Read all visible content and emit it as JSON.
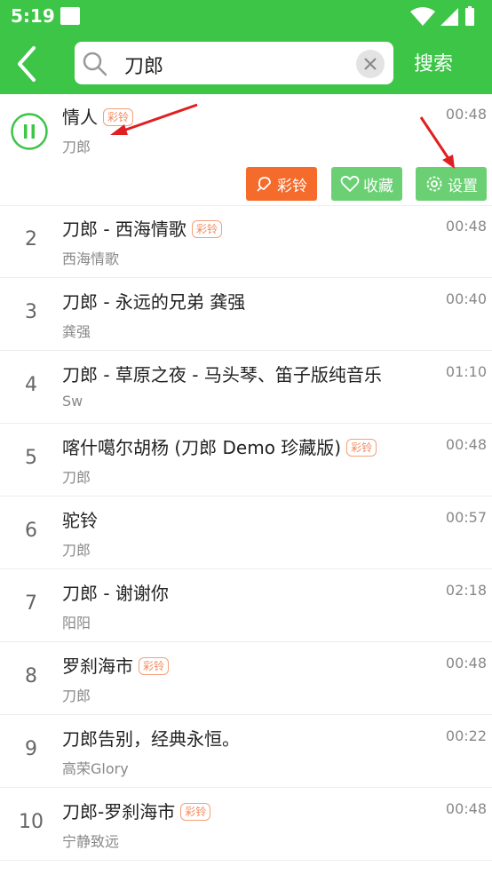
{
  "status_bar": {
    "time": "5:19"
  },
  "search": {
    "query": "刀郎",
    "submit_label": "搜索"
  },
  "badge_label": "彩铃",
  "now_playing": {
    "title": "情人",
    "artist": "刀郎",
    "duration": "00:48",
    "actions": {
      "ringtone": "彩铃",
      "favorite": "收藏",
      "settings": "设置"
    }
  },
  "songs": [
    {
      "num": "2",
      "title": "刀郎 - 西海情歌",
      "artist": "西海情歌",
      "duration": "00:48",
      "badge": true
    },
    {
      "num": "3",
      "title": "刀郎 - 永远的兄弟 龚强",
      "artist": "龚强",
      "duration": "00:40",
      "badge": false
    },
    {
      "num": "4",
      "title": "刀郎 - 草原之夜 - 马头琴、笛子版纯音乐",
      "artist": "Sw",
      "duration": "01:10",
      "badge": false
    },
    {
      "num": "5",
      "title": "喀什噶尔胡杨 (刀郎 Demo 珍藏版)",
      "artist": "刀郎",
      "duration": "00:48",
      "badge": true
    },
    {
      "num": "6",
      "title": "驼铃",
      "artist": "刀郎",
      "duration": "00:57",
      "badge": false
    },
    {
      "num": "7",
      "title": "刀郎 - 谢谢你",
      "artist": "阳阳",
      "duration": "02:18",
      "badge": false
    },
    {
      "num": "8",
      "title": "罗刹海市",
      "artist": "刀郎",
      "duration": "00:48",
      "badge": true
    },
    {
      "num": "9",
      "title": "刀郎告别，经典永恒。",
      "artist": "高荣Glory",
      "duration": "00:22",
      "badge": false
    },
    {
      "num": "10",
      "title": "刀郎-罗刹海市",
      "artist": "宁静致远",
      "duration": "00:48",
      "badge": true
    }
  ],
  "colors": {
    "header": "#3cc546",
    "ring_button": "#f46b2b",
    "green_button": "#6bd074",
    "badge": "#f08a5d",
    "annotation_arrow": "#e02020"
  }
}
